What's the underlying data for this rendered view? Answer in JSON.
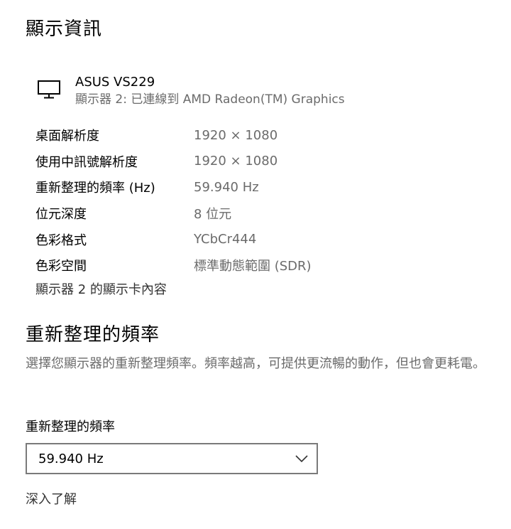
{
  "page": {
    "title": "顯示資訊"
  },
  "monitor": {
    "icon": "monitor-icon",
    "name": "ASUS VS229",
    "subtitle": "顯示器 2: 已連線到 AMD Radeon(TM) Graphics"
  },
  "info": {
    "rows": [
      {
        "key": "桌面解析度",
        "value": "1920 × 1080"
      },
      {
        "key": "使用中訊號解析度",
        "value": "1920 × 1080"
      },
      {
        "key": "重新整理的頻率 (Hz)",
        "value": "59.940 Hz"
      },
      {
        "key": "位元深度",
        "value": "8 位元"
      },
      {
        "key": "色彩格式",
        "value": "YCbCr444"
      },
      {
        "key": "色彩空間",
        "value": "標準動態範圍 (SDR)"
      }
    ],
    "adapter_link": "顯示器 2 的顯示卡內容"
  },
  "refresh": {
    "section_title": "重新整理的頻率",
    "description": "選擇您顯示器的重新整理頻率。頻率越高，可提供更流暢的動作，但也會更耗電。",
    "label": "重新整理的頻率",
    "selected": "59.940 Hz",
    "chevron_icon": "chevron-down-icon",
    "learn_more": "深入了解"
  }
}
